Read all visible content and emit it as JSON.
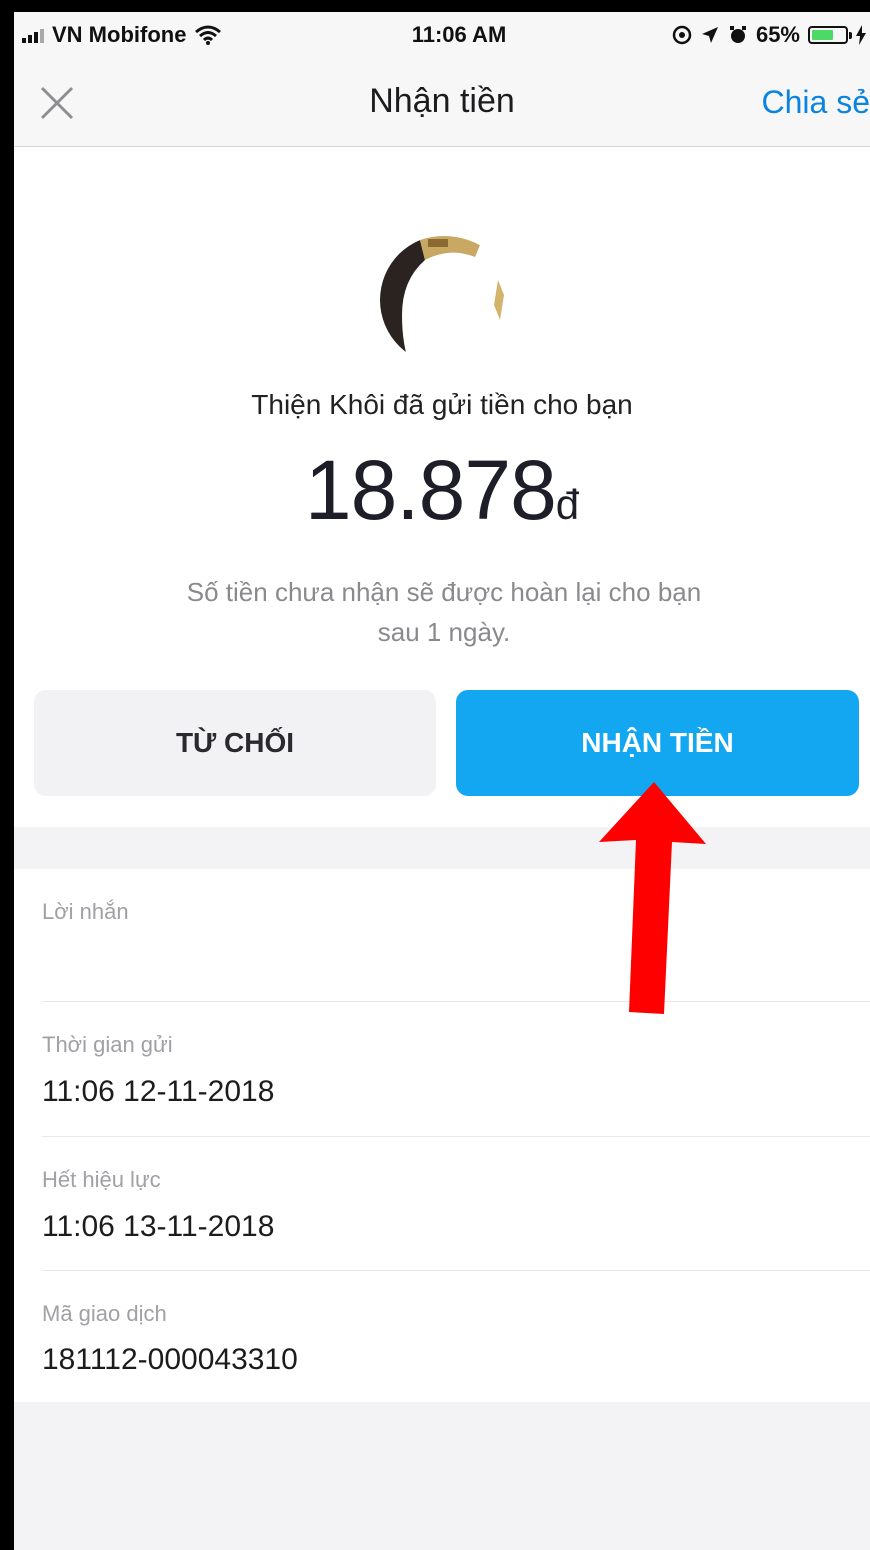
{
  "status_bar": {
    "carrier": "VN Mobifone",
    "time": "11:06 AM",
    "battery": "65%",
    "battery_level": 0.65
  },
  "nav": {
    "title": "Nhận tiền",
    "share_label": "Chia sẻ"
  },
  "transfer": {
    "sender_text": "Thiện Khôi đã gửi tiền cho bạn",
    "amount": "18.878",
    "currency": "đ",
    "note": "Số tiền chưa nhận sẽ được hoàn lại cho bạn sau 1 ngày.",
    "reject_label": "TỪ CHỐI",
    "accept_label": "NHẬN TIỀN"
  },
  "details": {
    "message_label": "Lời nhắn",
    "message_value": "",
    "sent_time_label": "Thời gian gửi",
    "sent_time_value": "11:06 12-11-2018",
    "expiry_label": "Hết hiệu lực",
    "expiry_value": "11:06 13-11-2018",
    "transaction_id_label": "Mã giao dịch",
    "transaction_id_value": "181112-000043310"
  },
  "colors": {
    "accent": "#13a7f2",
    "link": "#0a84e0",
    "annotation_arrow": "#ff0000"
  }
}
